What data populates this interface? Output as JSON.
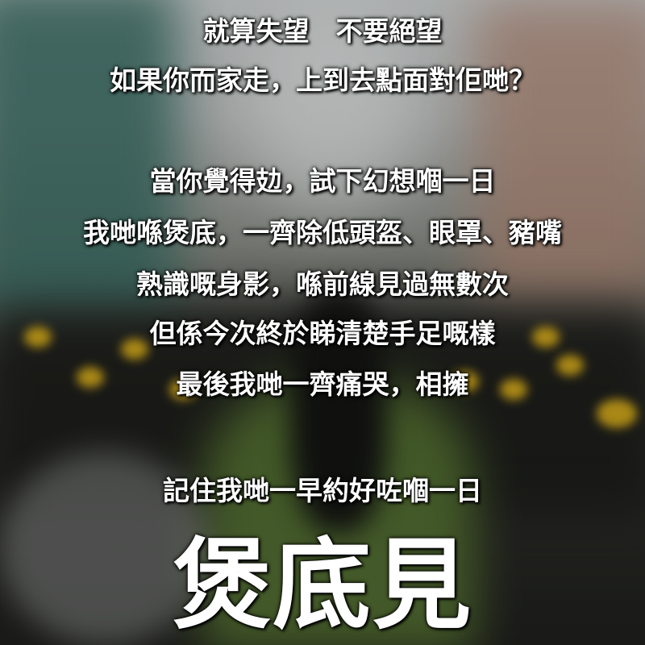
{
  "poster": {
    "lines": [
      "就算失望　不要絕望",
      "如果你而家走，上到去點面對佢哋？",
      "當你覺得攰，試下幻想嗰一日",
      "我哋喺煲底，一齊除低頭盔、眼罩、豬嘴",
      "熟識嘅身影，喺前線見過無數次",
      "但係今次終於睇清楚手足嘅樣",
      "最後我哋一齊痛哭，相擁",
      "記住我哋一早約好咗嗰一日"
    ],
    "headline": "煲底見"
  },
  "colors": {
    "text": "#ffffff",
    "helmet_yellow": "#e2b51b",
    "shadow": "#000000"
  }
}
